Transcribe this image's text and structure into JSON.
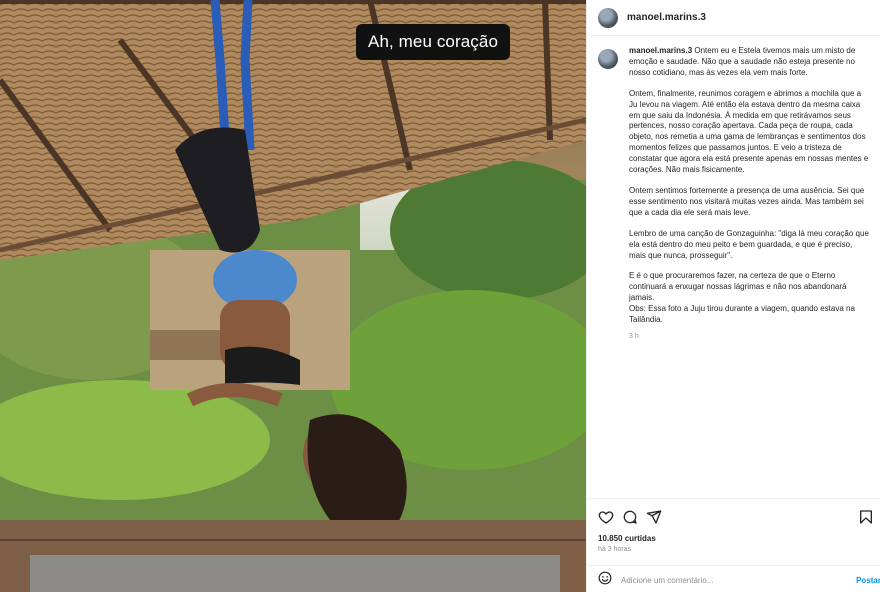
{
  "photo": {
    "caption": "Ah, meu coração"
  },
  "post": {
    "username": "manoel.marins.3",
    "caption_paragraphs": [
      "Ontem eu e Estela tivemos mais um misto de emoção e saudade. Não que a saudade não esteja presente no nosso cotidiano, mas às vezes ela vem mais forte.",
      "Ontem, finalmente, reunimos coragem e abrimos a mochila que a Ju levou na viagem. Até então ela estava dentro da mesma caixa em que saiu da Indonésia. À medida em que retirávamos seus pertences, nosso coração apertava. Cada peça de roupa, cada objeto, nos remetia a uma gama de lembranças e sentimentos dos momentos felizes que passamos juntos. E veio a tristeza de constatar que agora ela está presente apenas em nossas mentes e corações. Não mais fisicamente.",
      "Ontem sentimos fortemente a presença de uma ausência. Sei que esse sentimento nos visitará muitas vezes ainda. Mas também sei que a cada dia ele será mais leve.",
      "Lembro de uma canção de Gonzaguinha: \"diga lá meu coração que ela está dentro do meu peito e bem guardada, e que é preciso, mais que nunca, prosseguir\".",
      "E é o que procuraremos fazer, na certeza de que o Eterno continuará a enxugar nossas lágrimas e não nos abandonará jamais.\nObs: Essa foto a Juju tirou durante a viagem, quando estava na Tailândia."
    ],
    "caption_time": "3 h",
    "likes": "10.850 curtidas",
    "posted_ago": "há 3 horas"
  },
  "comment": {
    "placeholder": "Adicione um comentário...",
    "post_label": "Postar"
  },
  "icons": {
    "like": "heart-icon",
    "comment": "comment-icon",
    "share": "share-icon",
    "save": "bookmark-icon",
    "emoji": "emoji-icon"
  }
}
